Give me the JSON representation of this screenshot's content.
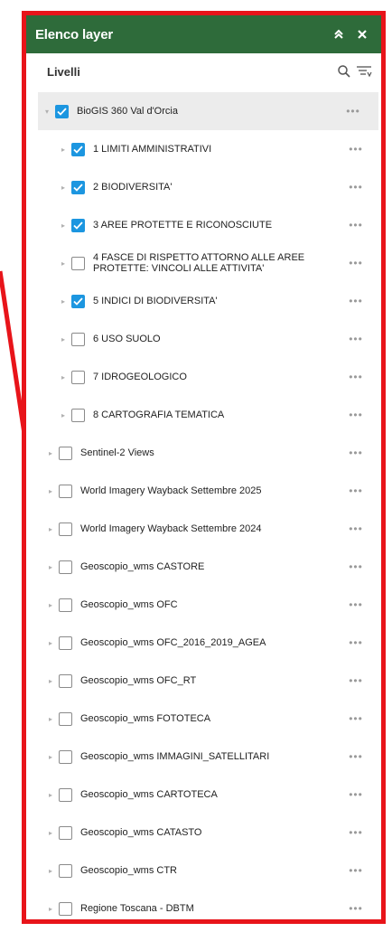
{
  "header": {
    "title": "Elenco layer",
    "collapse_icon": "chevrons-up-icon",
    "close_icon": "close-icon",
    "color": "#2e6b3a"
  },
  "subheader": {
    "title": "Livelli",
    "search_icon": "search-icon",
    "filter_icon": "filter-list-icon"
  },
  "more_label": "•••",
  "root": {
    "label": "BioGIS 360 Val d'Orcia",
    "checked": true
  },
  "children": [
    {
      "label": "1 LIMITI AMMINISTRATIVI",
      "checked": true
    },
    {
      "label": "2 BIODIVERSITA'",
      "checked": true
    },
    {
      "label": "3 AREE PROTETTE E RICONOSCIUTE",
      "checked": true
    },
    {
      "label": "4 FASCE DI RISPETTO ATTORNO ALLE AREE PROTETTE: VINCOLI ALLE ATTIVITA'",
      "checked": false
    },
    {
      "label": "5 INDICI DI BIODIVERSITA'",
      "checked": true
    },
    {
      "label": "6 USO SUOLO",
      "checked": false
    },
    {
      "label": "7 IDROGEOLOGICO",
      "checked": false
    },
    {
      "label": "8 CARTOGRAFIA TEMATICA",
      "checked": false
    }
  ],
  "layers": [
    {
      "label": "Sentinel-2 Views",
      "checked": false
    },
    {
      "label": "World Imagery Wayback Settembre 2025",
      "checked": false
    },
    {
      "label": "World Imagery Wayback Settembre 2024",
      "checked": false
    },
    {
      "label": "Geoscopio_wms CASTORE",
      "checked": false
    },
    {
      "label": "Geoscopio_wms OFC",
      "checked": false
    },
    {
      "label": "Geoscopio_wms OFC_2016_2019_AGEA",
      "checked": false
    },
    {
      "label": "Geoscopio_wms OFC_RT",
      "checked": false
    },
    {
      "label": "Geoscopio_wms FOTOTECA",
      "checked": false
    },
    {
      "label": "Geoscopio_wms IMMAGINI_SATELLITARI",
      "checked": false
    },
    {
      "label": "Geoscopio_wms CARTOTECA",
      "checked": false
    },
    {
      "label": "Geoscopio_wms CATASTO",
      "checked": false
    },
    {
      "label": "Geoscopio_wms CTR",
      "checked": false
    },
    {
      "label": "Regione Toscana - DBTM",
      "checked": false
    }
  ],
  "colors": {
    "border": "#e8141a",
    "checkbox_checked": "#1c96e0"
  }
}
